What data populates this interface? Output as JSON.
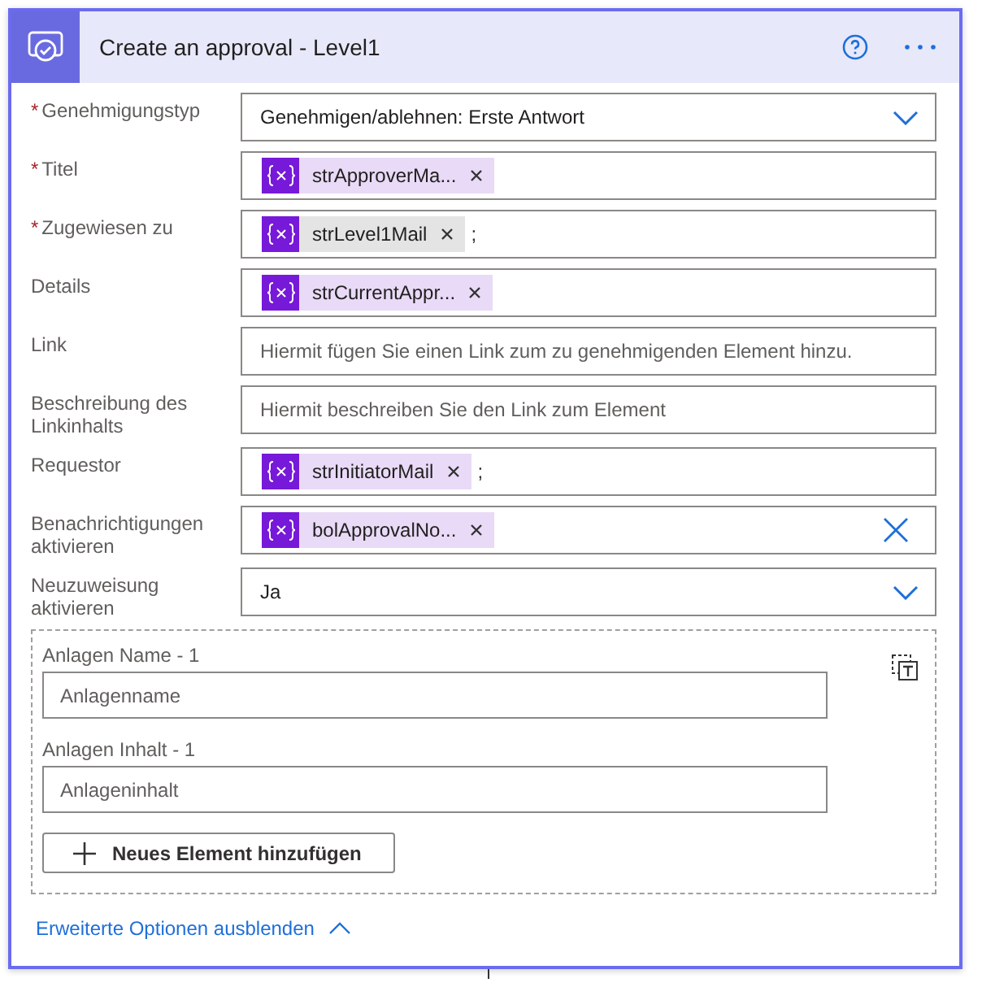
{
  "card": {
    "title": "Create an approval - Level1"
  },
  "fields": [
    {
      "label": "Genehmigungstyp",
      "required_mark": "*",
      "kind": "dropdown",
      "value": "Genehmigen/ablehnen: Erste Antwort"
    },
    {
      "label": "Titel",
      "required_mark": "*",
      "kind": "tokens",
      "tokens": [
        {
          "label": "strApproverMa...",
          "highlighted": false
        }
      ]
    },
    {
      "label": "Zugewiesen zu",
      "required_mark": "*",
      "kind": "tokens",
      "tokens": [
        {
          "label": "strLevel1Mail",
          "highlighted": true
        }
      ],
      "suffix": ";"
    },
    {
      "label": "Details",
      "kind": "tokens",
      "tokens": [
        {
          "label": "strCurrentAppr...",
          "highlighted": false
        }
      ]
    },
    {
      "label": "Link",
      "kind": "text",
      "placeholder": "Hiermit fügen Sie einen Link zum zu genehmigenden Element hinzu."
    },
    {
      "label": "Beschreibung des Linkinhalts",
      "kind": "text",
      "placeholder": "Hiermit beschreiben Sie den Link zum Element"
    },
    {
      "label": "Requestor",
      "kind": "tokens",
      "tokens": [
        {
          "label": "strInitiatorMail",
          "highlighted": false
        }
      ],
      "suffix": ";"
    },
    {
      "label": "Benachrichtigungen aktivieren",
      "kind": "tokens",
      "tokens": [
        {
          "label": "bolApprovalNo...",
          "highlighted": false
        }
      ],
      "clearable": true
    },
    {
      "label": "Neuzuweisung aktivieren",
      "kind": "dropdown",
      "value": "Ja"
    }
  ],
  "attachments": {
    "items": [
      {
        "label": "Anlagen Name - 1",
        "placeholder": "Anlagenname"
      },
      {
        "label": "Anlagen Inhalt - 1",
        "placeholder": "Anlageninhalt"
      }
    ],
    "add_button": "Neues Element hinzufügen"
  },
  "advanced_link": "Erweiterte Optionen ausblenden"
}
